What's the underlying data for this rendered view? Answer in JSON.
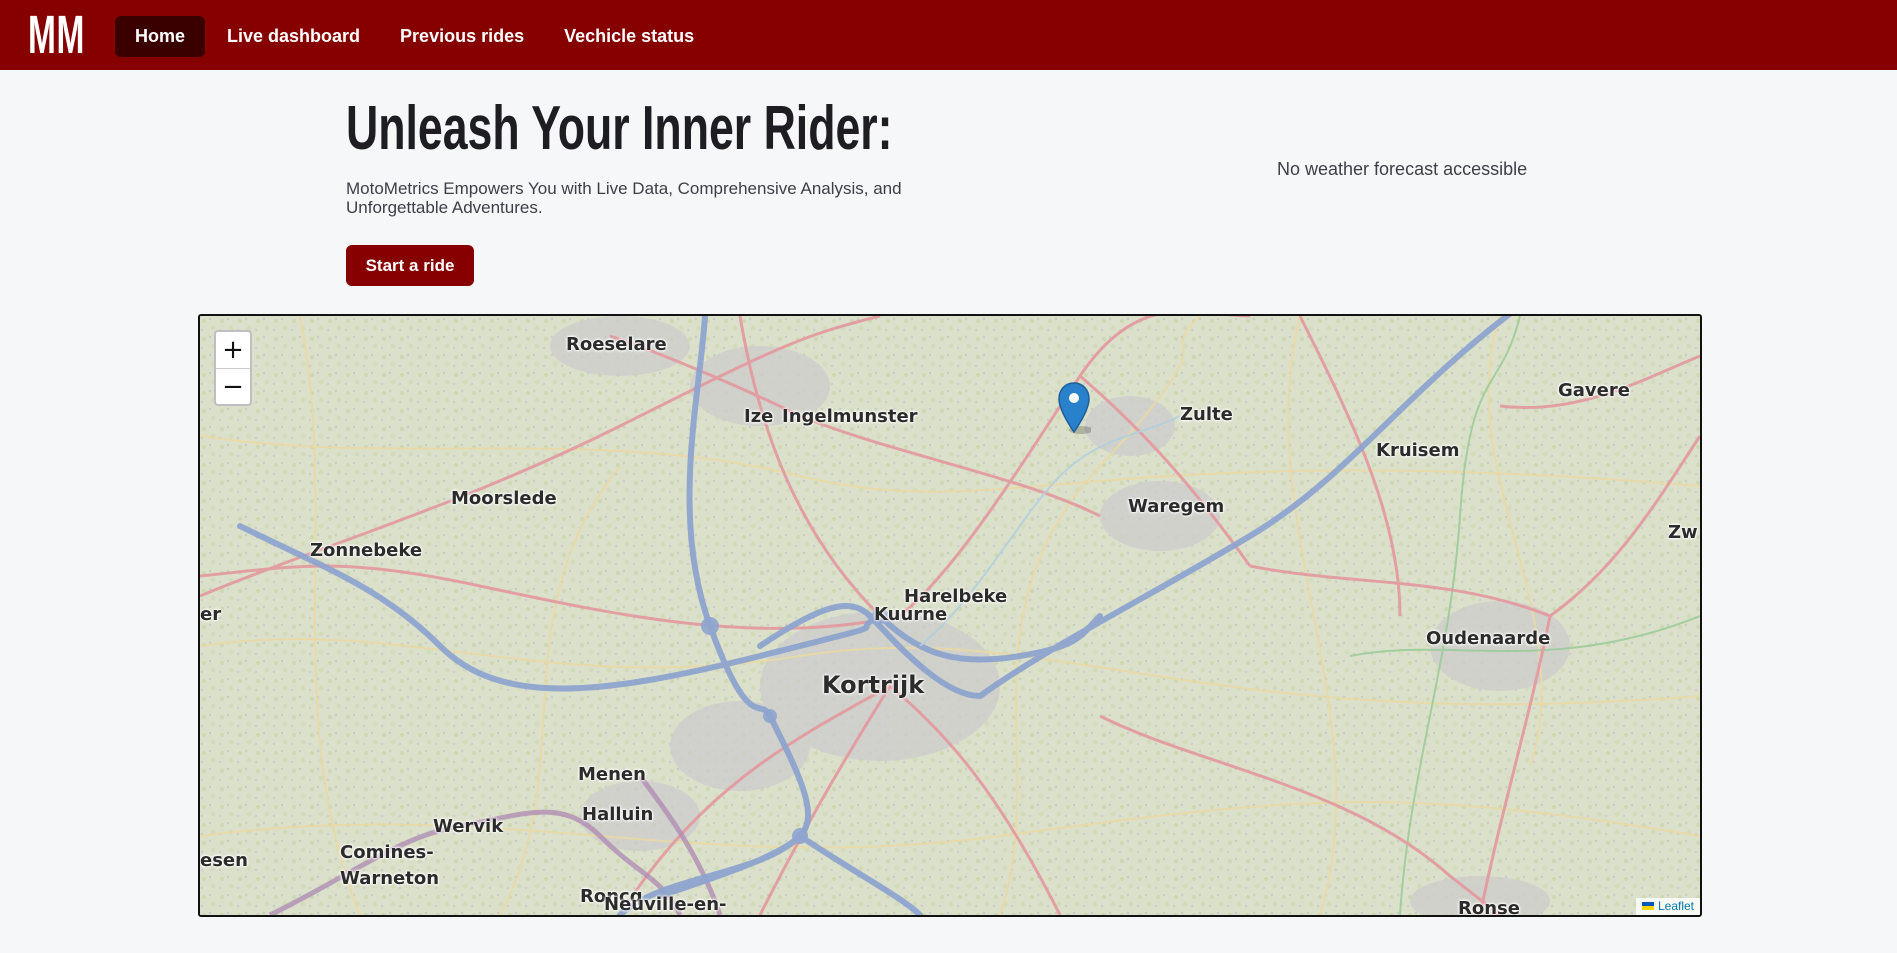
{
  "header": {
    "logo": "MM",
    "nav": [
      {
        "label": "Home",
        "active": true
      },
      {
        "label": "Live dashboard",
        "active": false
      },
      {
        "label": "Previous rides",
        "active": false
      },
      {
        "label": "Vechicle status",
        "active": false
      }
    ]
  },
  "hero": {
    "title": "Unleash Your Inner Rider:",
    "subtitle": "MotoMetrics Empowers You with Live Data, Comprehensive Analysis, and Unforgettable Adventures.",
    "button": "Start a ride"
  },
  "weather": {
    "text": "No weather forecast accessible"
  },
  "map": {
    "zoom_in": "+",
    "zoom_out": "−",
    "attribution": "Leaflet",
    "places": {
      "roeselare": "Roeselare",
      "izegem": "Ize",
      "ingelmunster": "Ingelmunster",
      "zulte": "Zulte",
      "gavere": "Gavere",
      "kruisem": "Kruisem",
      "moorslede": "Moorslede",
      "waregem": "Waregem",
      "zwalm": "Zw",
      "zonnebeke": "Zonnebeke",
      "ieper": "er",
      "harelbeke": "Harelbeke",
      "kuurne": "Kuurne",
      "oudenaarde": "Oudenaarde",
      "kortrijk": "Kortrijk",
      "menen": "Menen",
      "halluin": "Halluin",
      "wervik": "Wervik",
      "comines": "Comines-",
      "warneton": "Warneton",
      "heuvelland": "esen",
      "roncq": "Roncq",
      "neuville": "Neuville-en-",
      "ronse": "Ronse"
    },
    "colors": {
      "motorway": "#7f98c8",
      "primary_road": "#e08a92",
      "marker": "#2a81cb"
    }
  }
}
